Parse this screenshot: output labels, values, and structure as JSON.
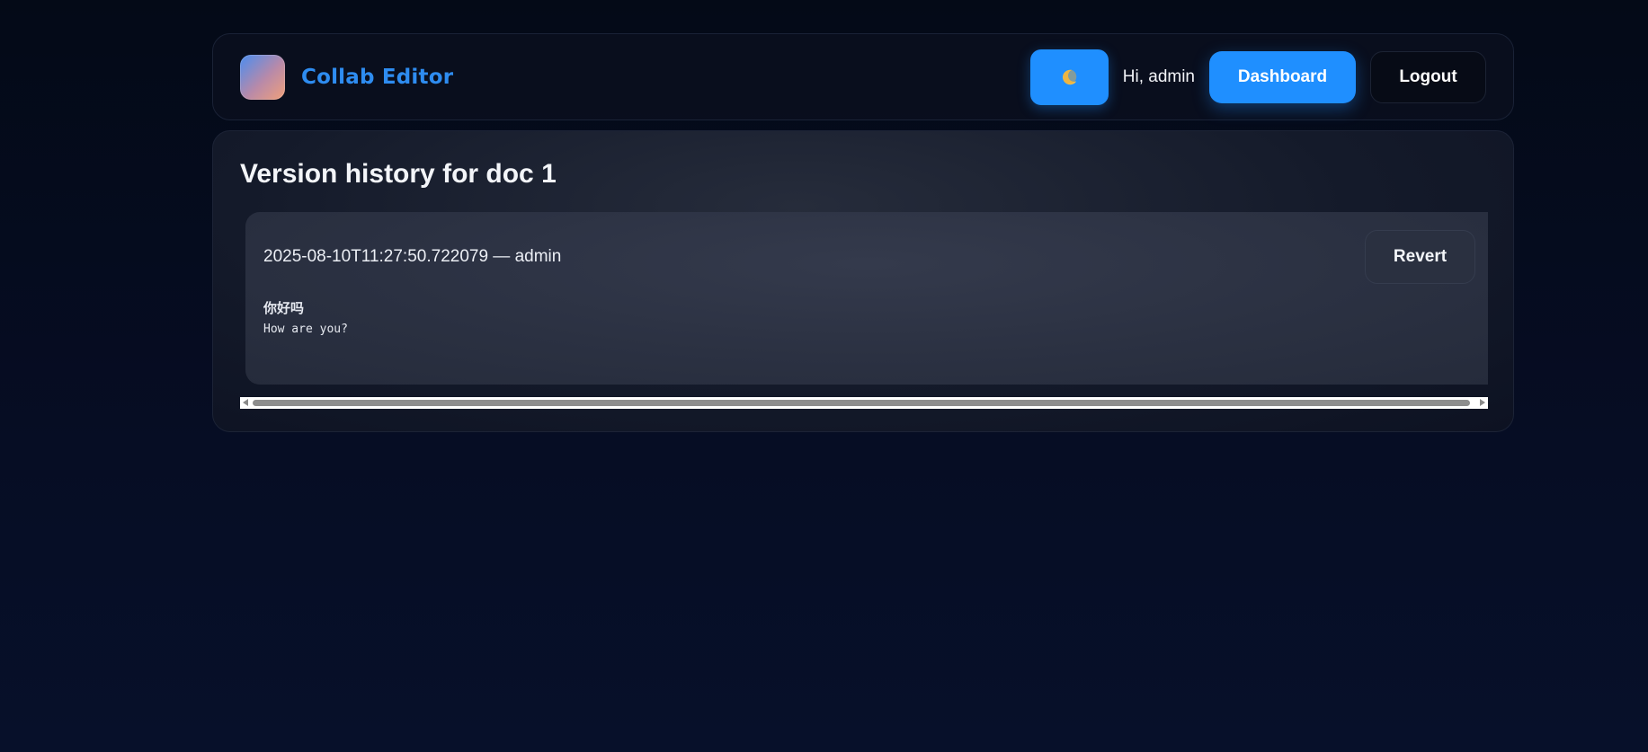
{
  "header": {
    "brand_name": "Collab Editor",
    "greeting": "Hi, admin",
    "dashboard_label": "Dashboard",
    "logout_label": "Logout",
    "theme_toggle_icon": "moon-icon"
  },
  "page": {
    "title": "Version history for doc 1"
  },
  "versions": [
    {
      "meta": "2025-08-10T11:27:50.722079 — admin",
      "revert_label": "Revert",
      "content_lines": [
        "你好吗",
        "How are you?"
      ]
    }
  ],
  "colors": {
    "accent": "#1f8fff",
    "brand_text": "#2e8cf0",
    "background": "#050b1c"
  }
}
